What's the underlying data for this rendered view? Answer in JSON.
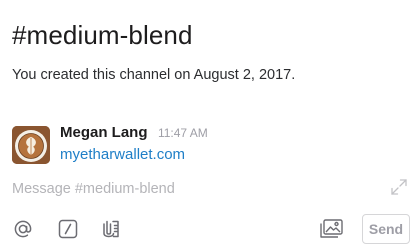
{
  "channel": {
    "title": "#medium-blend",
    "intro": "You created this channel on August 2, 2017."
  },
  "message": {
    "sender": "Megan Lang",
    "time": "11:47 AM",
    "link_text": "myetharwallet.com",
    "avatar_icon": "latte-art-avatar"
  },
  "composer": {
    "placeholder": "Message #medium-blend",
    "expand_icon": "expand-arrows-icon",
    "send_label": "Send"
  },
  "toolbar": {
    "icons": [
      "at-mention-icon",
      "slash-command-icon",
      "attach-file-icon",
      "image-upload-icon"
    ]
  },
  "colors": {
    "link": "#1f7fc7",
    "muted": "#9e9ea6",
    "placeholder": "#b4b4b8"
  }
}
